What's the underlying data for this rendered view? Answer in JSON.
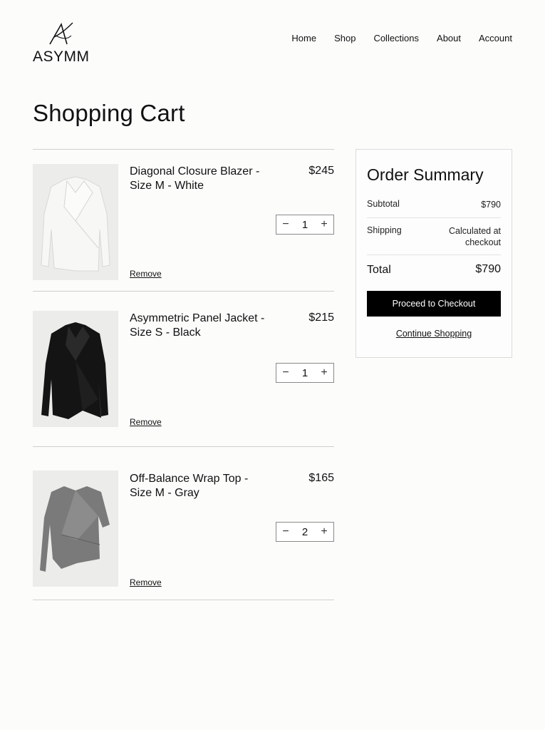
{
  "brand": {
    "name": "ASYMM"
  },
  "nav": [
    {
      "label": "Home"
    },
    {
      "label": "Shop"
    },
    {
      "label": "Collections"
    },
    {
      "label": "About"
    },
    {
      "label": "Account"
    }
  ],
  "page_title": "Shopping Cart",
  "cart": {
    "items": [
      {
        "name": "Diagonal Closure Blazer - Size M - White",
        "price": "$245",
        "quantity": "1",
        "decrement": "−",
        "increment": "+",
        "remove_label": "Remove",
        "image_icon": "white-blazer-image"
      },
      {
        "name": "Asymmetric Panel Jacket - Size S - Black",
        "price": "$215",
        "quantity": "1",
        "decrement": "−",
        "increment": "+",
        "remove_label": "Remove",
        "image_icon": "black-jacket-image"
      },
      {
        "name": "Off-Balance Wrap Top - Size M - Gray",
        "price": "$165",
        "quantity": "2",
        "decrement": "−",
        "increment": "+",
        "remove_label": "Remove",
        "image_icon": "gray-top-image"
      }
    ]
  },
  "summary": {
    "title": "Order Summary",
    "subtotal_label": "Subtotal",
    "subtotal_value": "$790",
    "shipping_label": "Shipping",
    "shipping_value": "Calculated at checkout",
    "total_label": "Total",
    "total_value": "$790",
    "checkout_label": "Proceed to Checkout",
    "continue_label": "Continue Shopping"
  },
  "colors": {
    "background": "#fcfcfb",
    "primary_button": "#000000",
    "divider": "#cfcfcf"
  }
}
